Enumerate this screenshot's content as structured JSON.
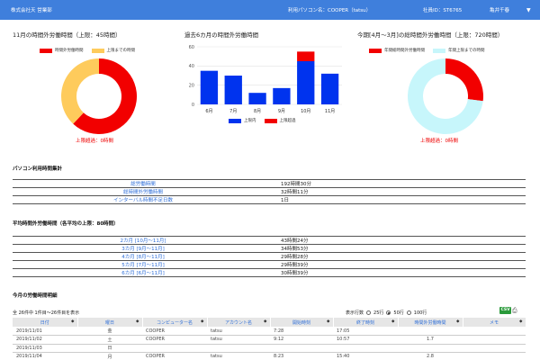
{
  "header": {
    "company": "株式会社天 営業部",
    "pc_label": "利用パソコン名：COOPER（tatsu）",
    "emp_label": "社員ID：ST6765",
    "user_name": "亀井千春",
    "caret": "▼"
  },
  "monthly": {
    "title": "11月の時間外労働時間（上限：45時間）",
    "legend_used": "時間外労働時間",
    "legend_remaining": "上限までの時間",
    "note": "上限超過：0時間",
    "colors": {
      "used": "#f20000",
      "remaining": "#fecb5c"
    }
  },
  "past6": {
    "title": "過去6カ月の時間外労働時間",
    "legend_within": "上限内",
    "legend_over": "上限超過",
    "colors": {
      "within": "#0033ee",
      "over": "#f20000"
    }
  },
  "annual": {
    "title": "今期[4月～3月]の総時間外労働時間（上限：720時間）",
    "legend_used": "年間総時間外労働時間",
    "legend_remaining": "年間上限までの時間",
    "note": "上限超過：0時間",
    "colors": {
      "used": "#f20000",
      "remaining": "#c7f6fb"
    }
  },
  "chart_data": [
    {
      "type": "pie",
      "series": [
        {
          "name": "時間外労働時間",
          "value": 62
        },
        {
          "name": "上限までの時間",
          "value": 38
        }
      ]
    },
    {
      "type": "bar",
      "categories": [
        "6月",
        "7月",
        "8月",
        "9月",
        "10月",
        "11月"
      ],
      "series": [
        {
          "name": "上限内",
          "values": [
            35,
            30,
            12,
            17,
            45,
            32
          ]
        },
        {
          "name": "上限超過",
          "values": [
            0,
            0,
            0,
            0,
            10,
            0
          ]
        }
      ],
      "ylim": [
        0,
        60
      ],
      "yticks": [
        0,
        20,
        40,
        60
      ]
    },
    {
      "type": "pie",
      "series": [
        {
          "name": "年間総時間外労働時間",
          "value": 27
        },
        {
          "name": "年間上限までの時間",
          "value": 73
        }
      ]
    }
  ],
  "usage": {
    "title": "パソコン利用時間集計",
    "rows": [
      {
        "label": "総労働時間",
        "value": "192時間30分"
      },
      {
        "label": "総時間外労働時間",
        "value": "32時間11分"
      },
      {
        "label": "インターバル時間不足日数",
        "value": "1日"
      }
    ]
  },
  "average": {
    "title": "平均時間外労働時間（各平均の上限：80時間）",
    "rows": [
      {
        "label": "2カ月 [10月～11月]",
        "value": "43時間24分"
      },
      {
        "label": "3カ月 [9月～11月]",
        "value": "34時間53分"
      },
      {
        "label": "4カ月 [8月～11月]",
        "value": "29時間28分"
      },
      {
        "label": "5カ月 [7月～11月]",
        "value": "29時間39分"
      },
      {
        "label": "6カ月 [6月～11月]",
        "value": "30時間39分"
      }
    ]
  },
  "detail": {
    "title": "今月の労働時間明細",
    "count_text": "全 26件中 1件目～26件目を表示",
    "per_page_label": "表示行数",
    "per_page_options": [
      "25行",
      "50行",
      "100行"
    ],
    "per_page_selected": 1,
    "csv_label": "CSV",
    "columns": [
      "日付",
      "曜日",
      "コンピューター名",
      "アカウント名",
      "開始時刻",
      "終了時刻",
      "時間外労働時間",
      "メモ"
    ],
    "rows": [
      [
        "2019/11/01",
        "金",
        "COOPER",
        "tatsu",
        "7:28",
        "17:05",
        "",
        ""
      ],
      [
        "2019/11/02",
        "土",
        "COOPER",
        "tatsu",
        "9:12",
        "10:57",
        "1.7",
        ""
      ],
      [
        "2019/11/03",
        "日",
        "",
        "",
        "",
        "",
        "",
        ""
      ],
      [
        "2019/11/04",
        "月",
        "COOPER",
        "tatsu",
        "8:23",
        "15:40",
        "2.8",
        ""
      ]
    ]
  }
}
